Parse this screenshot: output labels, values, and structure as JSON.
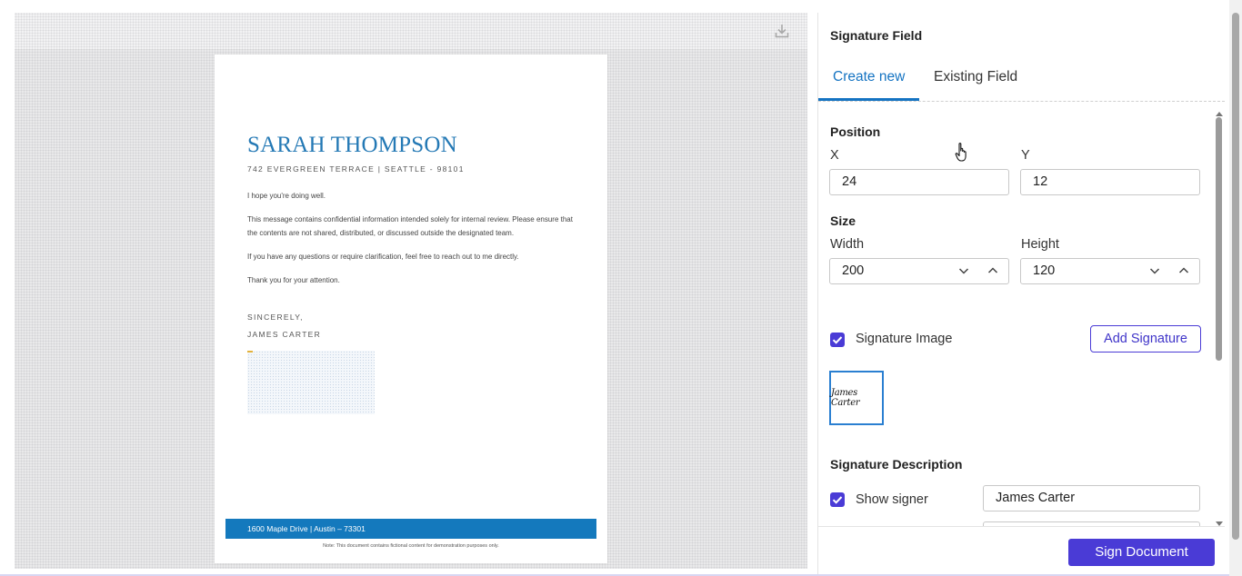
{
  "viewer": {
    "download_icon": "download-icon",
    "document": {
      "name": "SARAH THOMPSON",
      "address": "742 EVERGREEN TERRACE | SEATTLE - 98101",
      "paragraphs": [
        "I hope you're doing well.",
        "This message contains confidential information intended solely for internal review. Please ensure that the contents are not shared, distributed, or discussed outside the designated team.",
        "If you have any questions or require clarification, feel free to reach out to me directly.",
        "Thank you for your attention."
      ],
      "closing": "SINCERELY,",
      "signer": "JAMES CARTER",
      "footer_address": "1600 Maple Drive | Austin – 73301",
      "footer_note": "Note: This document contains fictional content for demonstration purposes only."
    }
  },
  "panel": {
    "title": "Signature Field",
    "tabs": [
      {
        "label": "Create new",
        "active": true
      },
      {
        "label": "Existing Field",
        "active": false
      }
    ],
    "position": {
      "label": "Position",
      "x_label": "X",
      "x_value": "24",
      "y_label": "Y",
      "y_value": "12"
    },
    "size": {
      "label": "Size",
      "width_label": "Width",
      "width_value": "200",
      "height_label": "Height",
      "height_value": "120"
    },
    "signature_image": {
      "checkbox_label": "Signature Image",
      "checked": true,
      "add_button": "Add Signature",
      "thumbnail_text": "James Carter"
    },
    "signature_description": {
      "label": "Signature Description",
      "show_signer_label": "Show signer",
      "show_signer_checked": true,
      "signer_value": "James Carter"
    },
    "sign_button": "Sign Document"
  },
  "colors": {
    "accent": "#4a3bd6",
    "tab_active": "#1473c2",
    "doc_heading": "#2479b5",
    "doc_footer_bar": "#1479bd"
  }
}
